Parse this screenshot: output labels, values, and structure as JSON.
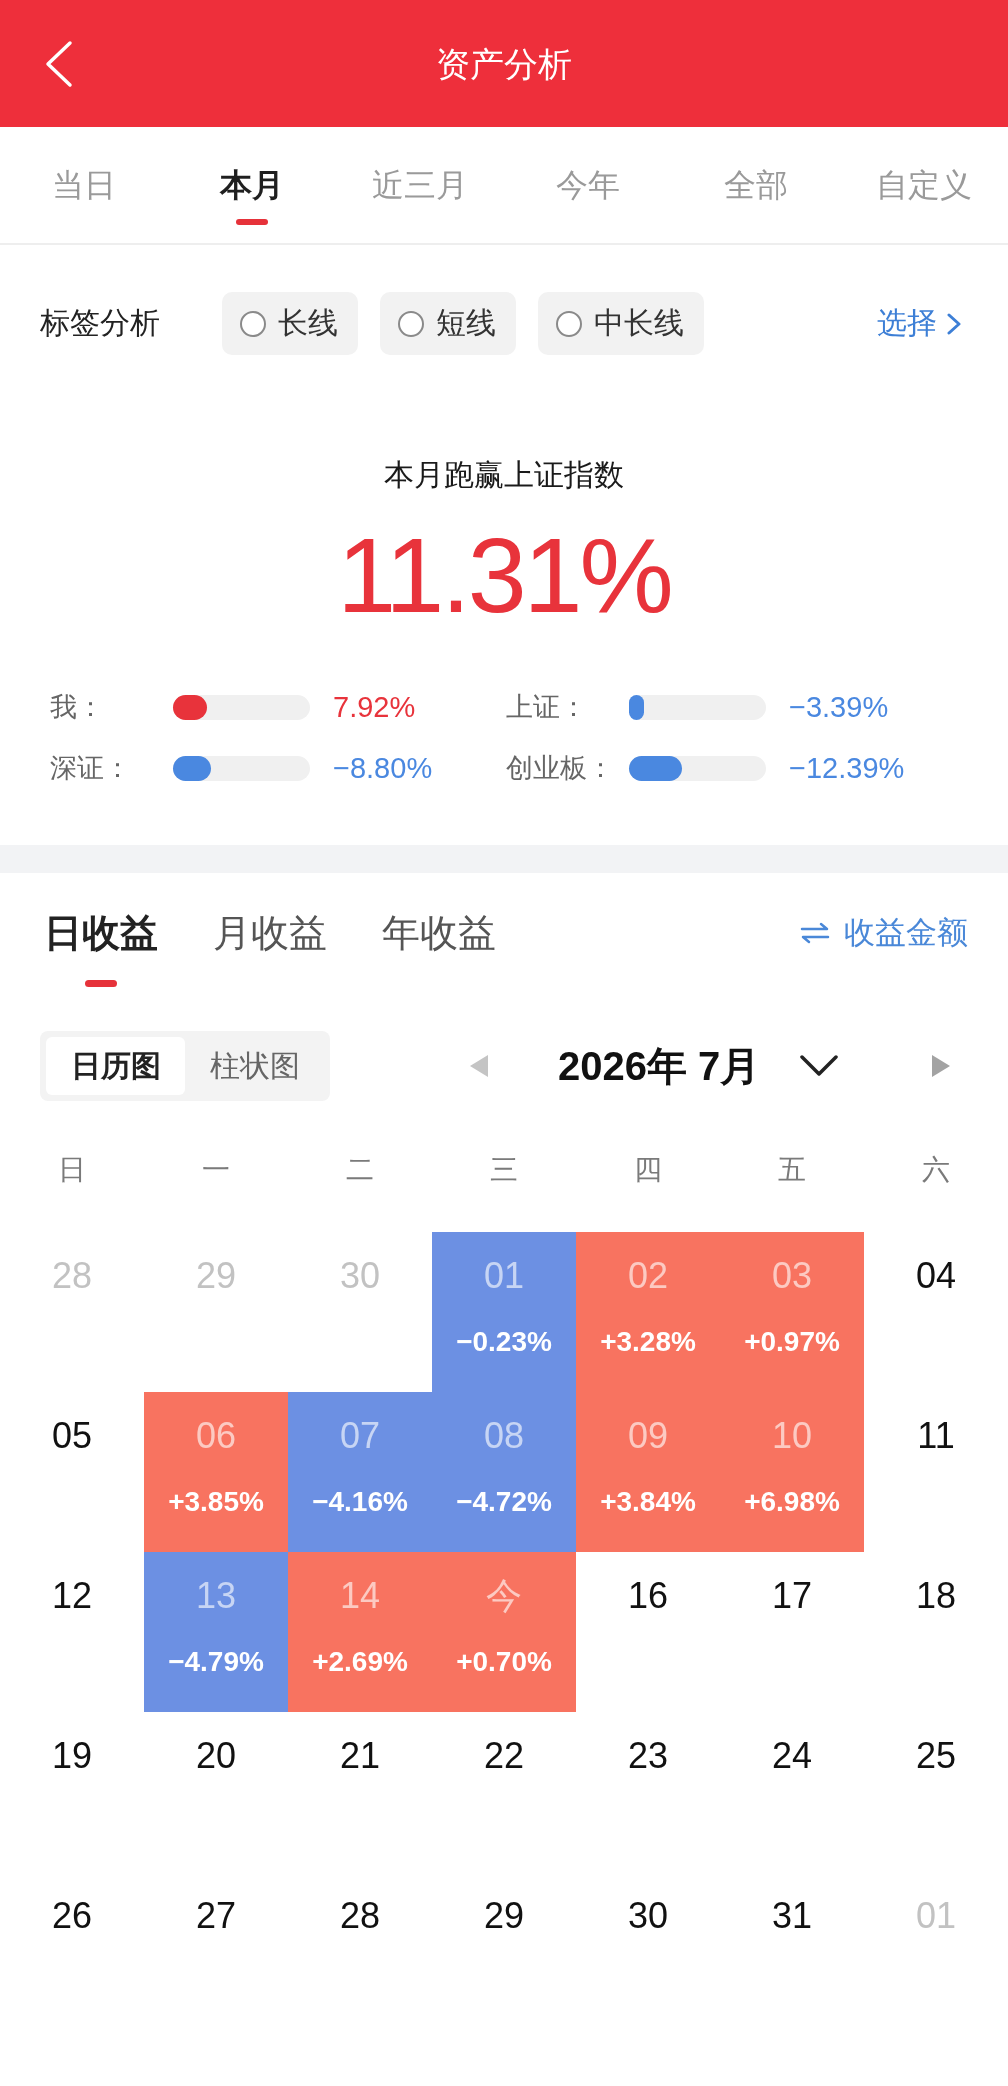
{
  "header": {
    "title": "资产分析"
  },
  "period_tabs": [
    {
      "label": "当日",
      "selected": false
    },
    {
      "label": "本月",
      "selected": true
    },
    {
      "label": "近三月",
      "selected": false
    },
    {
      "label": "今年",
      "selected": false
    },
    {
      "label": "全部",
      "selected": false
    },
    {
      "label": "自定义",
      "selected": false
    }
  ],
  "tag_filter": {
    "label": "标签分析",
    "chips": [
      {
        "label": "长线",
        "checked": false
      },
      {
        "label": "短线",
        "checked": false
      },
      {
        "label": "中长线",
        "checked": false
      }
    ],
    "action": "选择"
  },
  "summary": {
    "title": "本月跑赢上证指数",
    "value": "11.31%",
    "benchmarks": [
      {
        "label": "我：",
        "level": 0.25,
        "value": "7.92%",
        "color": "#e8333b"
      },
      {
        "label": "上证：",
        "level": 0.11,
        "value": "−3.39%",
        "color": "#4a88e0"
      },
      {
        "label": "深证：",
        "level": 0.28,
        "value": "−8.80%",
        "color": "#4a88e0"
      },
      {
        "label": "创业板：",
        "level": 0.39,
        "value": "−12.39%",
        "color": "#4a88e0"
      }
    ]
  },
  "earnings": {
    "tabs": [
      {
        "label": "日收益",
        "selected": true
      },
      {
        "label": "月收益",
        "selected": false
      },
      {
        "label": "年收益",
        "selected": false
      }
    ],
    "toggle": "收益金额",
    "views": [
      {
        "label": "日历图",
        "selected": true
      },
      {
        "label": "柱状图",
        "selected": false
      }
    ],
    "month": "2026年 7月",
    "weekdays": [
      "日",
      "一",
      "二",
      "三",
      "四",
      "五",
      "六"
    ],
    "days": [
      {
        "day": "28",
        "kind": "outside"
      },
      {
        "day": "29",
        "kind": "outside"
      },
      {
        "day": "30",
        "kind": "outside"
      },
      {
        "day": "01",
        "kind": "trade",
        "change": "−0.23%",
        "color": "#6c90e3"
      },
      {
        "day": "02",
        "kind": "trade",
        "change": "+3.28%",
        "color": "#f87360"
      },
      {
        "day": "03",
        "kind": "trade",
        "change": "+0.97%",
        "color": "#f87360"
      },
      {
        "day": "04",
        "kind": "day"
      },
      {
        "day": "05",
        "kind": "day"
      },
      {
        "day": "06",
        "kind": "trade",
        "change": "+3.85%",
        "color": "#f87360"
      },
      {
        "day": "07",
        "kind": "trade",
        "change": "−4.16%",
        "color": "#6c90e3"
      },
      {
        "day": "08",
        "kind": "trade",
        "change": "−4.72%",
        "color": "#6c90e3"
      },
      {
        "day": "09",
        "kind": "trade",
        "change": "+3.84%",
        "color": "#f87360"
      },
      {
        "day": "10",
        "kind": "trade",
        "change": "+6.98%",
        "color": "#f87360"
      },
      {
        "day": "11",
        "kind": "day"
      },
      {
        "day": "12",
        "kind": "day"
      },
      {
        "day": "13",
        "kind": "trade",
        "change": "−4.79%",
        "color": "#6c90e3"
      },
      {
        "day": "14",
        "kind": "trade",
        "change": "+2.69%",
        "color": "#f87360"
      },
      {
        "day": "今",
        "kind": "trade",
        "change": "+0.70%",
        "color": "#f87360"
      },
      {
        "day": "16",
        "kind": "day"
      },
      {
        "day": "17",
        "kind": "day"
      },
      {
        "day": "18",
        "kind": "day"
      },
      {
        "day": "19",
        "kind": "day"
      },
      {
        "day": "20",
        "kind": "day"
      },
      {
        "day": "21",
        "kind": "day"
      },
      {
        "day": "22",
        "kind": "day"
      },
      {
        "day": "23",
        "kind": "day"
      },
      {
        "day": "24",
        "kind": "day"
      },
      {
        "day": "25",
        "kind": "day"
      },
      {
        "day": "26",
        "kind": "day"
      },
      {
        "day": "27",
        "kind": "day"
      },
      {
        "day": "28",
        "kind": "day"
      },
      {
        "day": "29",
        "kind": "day"
      },
      {
        "day": "30",
        "kind": "day"
      },
      {
        "day": "31",
        "kind": "day"
      },
      {
        "day": "01",
        "kind": "outside"
      }
    ]
  }
}
